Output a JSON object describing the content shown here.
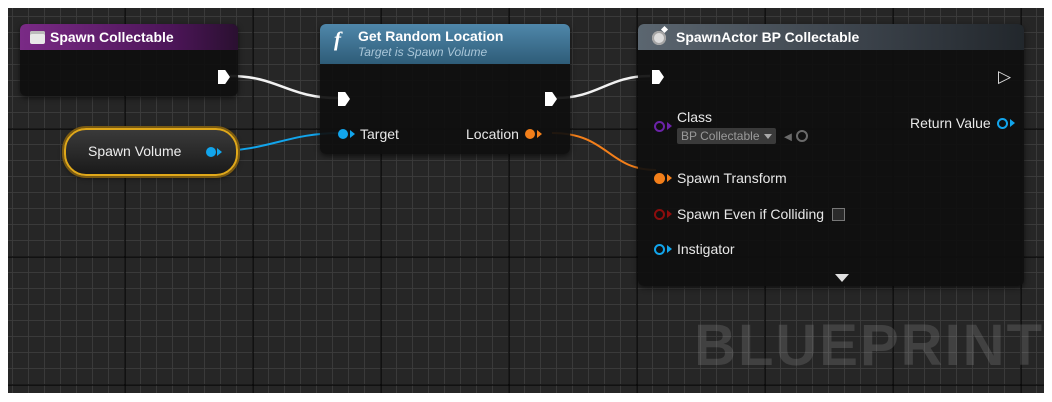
{
  "nodes": {
    "spawn_collectable": {
      "title": "Spawn Collectable"
    },
    "get_random_location": {
      "title": "Get Random Location",
      "subtitle": "Target is Spawn Volume",
      "pin_target": "Target",
      "pin_location": "Location"
    },
    "spawn_volume": {
      "label": "Spawn Volume"
    },
    "spawn_actor": {
      "title": "SpawnActor BP Collectable",
      "pin_class": "Class",
      "class_value": "BP Collectable",
      "pin_return": "Return Value",
      "pin_spawn_transform": "Spawn Transform",
      "pin_spawn_even": "Spawn Even if Colliding",
      "pin_instigator": "Instigator"
    }
  },
  "watermark": "BLUEPRINT",
  "colors": {
    "event_header": "#6a1f74",
    "function_header": "#3b6f8f",
    "spawn_header": "#4a5560",
    "object_pin": "#12a5ec",
    "struct_pin": "#f37f1a",
    "class_pin": "#6b23a8",
    "bool_pin": "#8c0d0d",
    "select_outline": "#e0a81a"
  },
  "icons": {
    "event": "event-square-icon",
    "function": "function-f-icon",
    "spawn": "spawn-gear-icon"
  }
}
